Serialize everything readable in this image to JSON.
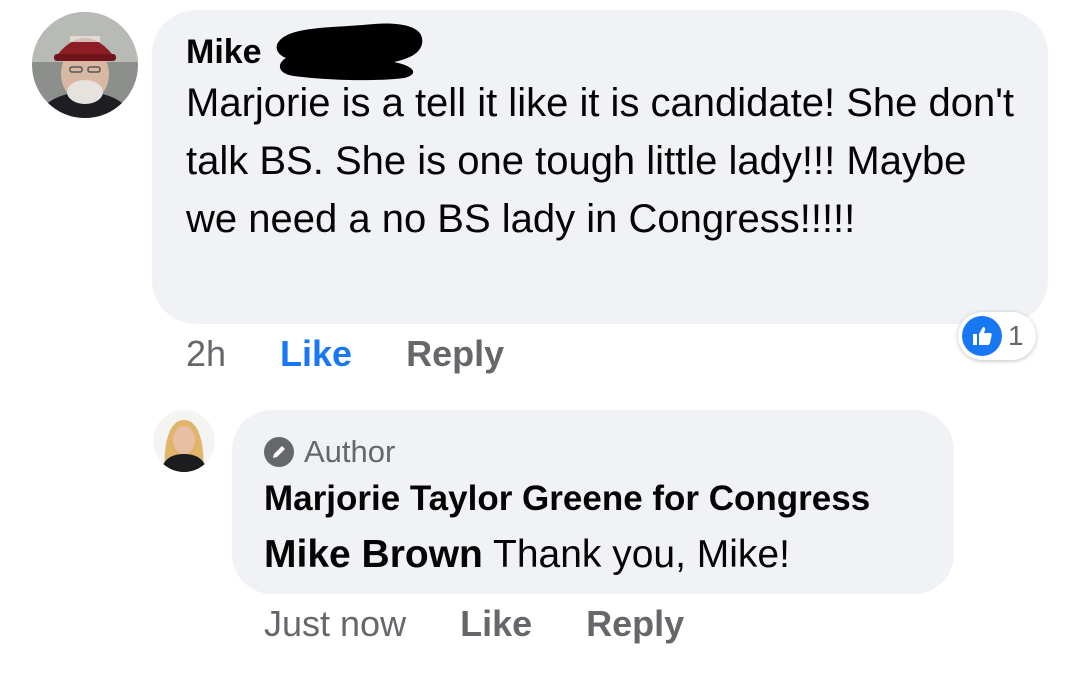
{
  "comment": {
    "author": "Mike",
    "text": "Marjorie is a tell it like it is candidate! She don't talk BS. She is one tough little lady!!! Maybe we need a no BS lady in Congress!!!!!",
    "time": "2h",
    "like_label": "Like",
    "reply_label": "Reply",
    "reaction_count": "1",
    "colors": {
      "bubble": "#f0f2f5",
      "like_active": "#1877f2",
      "meta": "#65676b"
    }
  },
  "reply": {
    "badge": "Author",
    "page_name": "Marjorie Taylor Greene for Congress",
    "mention": "Mike Brown",
    "text": " Thank you, Mike!",
    "time": "Just now",
    "like_label": "Like",
    "reply_label": "Reply"
  }
}
